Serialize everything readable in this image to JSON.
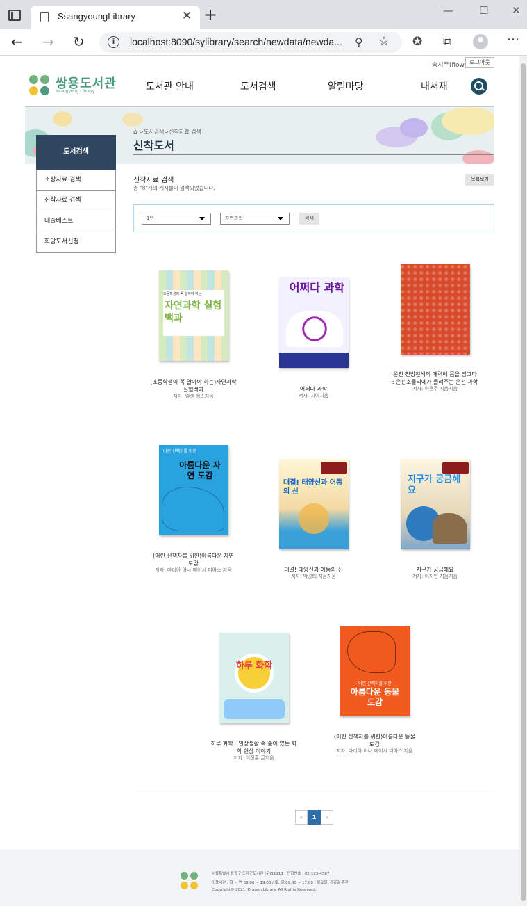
{
  "browser": {
    "tab_title": "SsangyoungLibrary",
    "url": "localhost:8090/sylibrary/search/newdata/newda...",
    "tab_close": "✕",
    "new_tab": "+",
    "minimize": "—",
    "maximize": "☐",
    "close": "✕",
    "icons": [
      "tab-actions-icon",
      "page-icon",
      "back-icon",
      "forward-icon",
      "refresh-icon",
      "info-icon",
      "zoom-icon",
      "add-favorite-icon",
      "favorites-icon",
      "collections-icon",
      "profile-icon",
      "more-icon"
    ]
  },
  "header": {
    "user": "송시주(fiowo)",
    "logout": "로그아웃",
    "logo_text": "쌍용도서관",
    "logo_sub": "ssangyong Library",
    "nav": [
      "도서관 안내",
      "도서검색",
      "알림마당",
      "내서재"
    ]
  },
  "banner": {
    "breadcrumb": ">도서검색>신착자료 검색",
    "title": "신착도서"
  },
  "sidebar": {
    "heading": "도서검색",
    "items": [
      "소장자료 검색",
      "신착자료 검색",
      "대출베스트",
      "희망도서신청"
    ]
  },
  "content": {
    "section_title": "신착자료 검색",
    "result_count": "총 \"8\"개의 게시물이 검색되었습니다.",
    "list_view_button": "목록보기",
    "filter_period": "1년",
    "filter_category": "자연과학",
    "search_button": "검색"
  },
  "books": [
    {
      "title": "(초등학생이 꼭 알아야 하는)자연과학 실험백과",
      "author": "저자: 엘렌 펭스지음",
      "cover_text": "자연과학 실험백과",
      "cover_top": "초등학생이 꼭 알아야 하는"
    },
    {
      "title": "어쩌다 과학",
      "author": "저자: 지이지음",
      "cover_text": "어쩌다 과학",
      "cover_top": ""
    },
    {
      "title": "은천 천방천색의 매력에 몸을 담그다 : 은천소믈리에가 들려주는 은천 과학",
      "author": "저자: 이은주 지음지음",
      "cover_text": "",
      "cover_top": ""
    },
    {
      "title": "(어린 산책자를 위한)아름다운 자연 도감",
      "author": "저자: 마리아 아나 페이시 디아스 지음",
      "cover_text": "아름다운 자연 도감",
      "cover_top": "어린 산책자를 위한"
    },
    {
      "title": "대결! 태양신과 어둠의 신",
      "author": "저자: 박경태 지음지음",
      "cover_text": "대결! 태양신과 어둠의 신",
      "cover_top": ""
    },
    {
      "title": "지구가 궁금해요",
      "author": "저자: 이지현 지음지음",
      "cover_text": "지구가 궁금해요",
      "cover_top": ""
    },
    {
      "title": "하루 화학 : 일상생활 속 숨어 있는 화학 현상 이야기",
      "author": "저자: 이정훈 글지음",
      "cover_text": "하루 화학",
      "cover_top": ""
    },
    {
      "title": "(어린 산책자를 위한)아름다운 동물 도감",
      "author": "저자: 마리아 아나 페이시 디아스 지음",
      "cover_text": "아름다운 동물 도감",
      "cover_top": "어린 산책자를 위한"
    }
  ],
  "pagination": {
    "prev": "«",
    "current": "1",
    "next": "»"
  },
  "footer": {
    "line1": "서울특별시 용동구 드래곤도서관 (우)11111 | 전화번호 : 02-123-4567",
    "line2": "이용시간 : 화 ~ 연 09:00 ~ 19:00 / 토, 일 09:00 ~ 17:00 / 월요일, 공휴일 휴관",
    "line3": "Copyright© 2021. Dragon Library. All Rights Reserved."
  },
  "colors": {
    "brand": "#4c9a80",
    "sidebar_head": "#2f4560",
    "pager_active": "#2f6ea8",
    "filter_border": "#a9dbe8"
  }
}
